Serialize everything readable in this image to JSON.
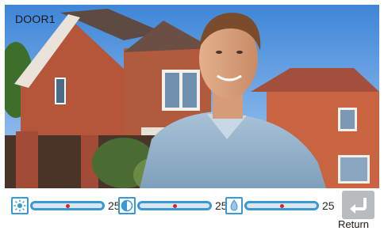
{
  "camera": {
    "door_label": "DOOR1"
  },
  "controls": {
    "brightness": {
      "icon": "brightness-icon",
      "value_text": "25",
      "level": 0.5
    },
    "contrast": {
      "icon": "contrast-icon",
      "value_text": "25",
      "level": 0.5
    },
    "color": {
      "icon": "color-drop-icon",
      "value_text": "25",
      "level": 0.5
    }
  },
  "return_button": {
    "icon": "return-arrow-icon",
    "label": "Return"
  },
  "colors": {
    "accent": "#3a98d6",
    "knob": "#e02020",
    "return_bg": "#b9bcbf"
  }
}
